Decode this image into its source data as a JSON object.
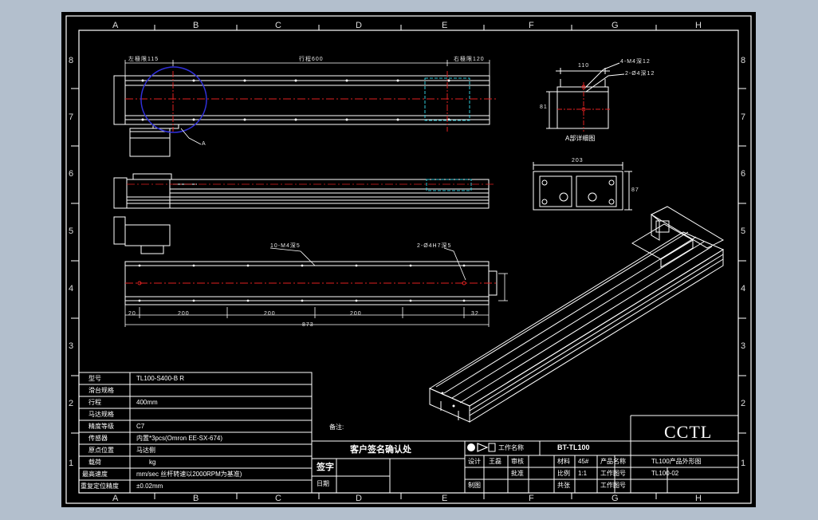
{
  "drawing": {
    "zone_columns": [
      "A",
      "B",
      "C",
      "D",
      "E",
      "F",
      "G",
      "H"
    ],
    "zone_rows": [
      "8",
      "7",
      "6",
      "5",
      "4",
      "3",
      "2",
      "1"
    ],
    "top_view": {
      "dim_left": "左極限115",
      "dim_stroke": "行程600",
      "dim_right": "右極限120",
      "callout": "A"
    },
    "side_view": {
      "note_left": "10-M4深5",
      "note_right": "2-Ø4H7深5",
      "dims": [
        "20",
        "200",
        "200",
        "200",
        "32"
      ],
      "total": "873"
    },
    "detail": {
      "caption": "A部详细图",
      "width": "110",
      "height": "81",
      "note_1": "4-M4深12",
      "note_2": "2-Ø4深12"
    },
    "end_view": {
      "width": "203",
      "height": "87"
    }
  },
  "spec_table": {
    "rows": [
      {
        "label": "型号",
        "value": "TL100-S400-B R"
      },
      {
        "label": "滑台规格",
        "value": ""
      },
      {
        "label": "行程",
        "value": "400mm"
      },
      {
        "label": "马达规格",
        "value": ""
      },
      {
        "label": "精度等级",
        "value": "C7"
      },
      {
        "label": "传感器",
        "value": "内置*3pcs(Omron EE-SX-674)"
      },
      {
        "label": "原点位置",
        "value": "马达侧"
      },
      {
        "label": "载荷",
        "value": "kg"
      },
      {
        "label": "最高速度",
        "value": "mm/sec 丝杆转速以2000RPM为基准)"
      },
      {
        "label": "重复定位精度",
        "value": "±0.02mm"
      }
    ]
  },
  "notes_label": "备注:",
  "confirm_label": "客户签名确认处",
  "sign_label": "签字",
  "date_label": "日期",
  "title_block": {
    "work_name_label": "工作名称",
    "work_name_value": "BT-TL100",
    "brand": "CCTL",
    "rows": [
      [
        "设计",
        "王磊",
        "审核",
        "",
        "材料",
        "45#",
        "产品名称",
        "TL100产品外形图"
      ],
      [
        "",
        "",
        "",
        "批准",
        "比例",
        "1:1",
        "工作图号",
        "TL100-02"
      ],
      [
        "制图",
        "",
        "",
        "",
        "",
        "",
        "",
        ""
      ]
    ],
    "label_page": "共张",
    "label_sheet": "工作图号"
  }
}
